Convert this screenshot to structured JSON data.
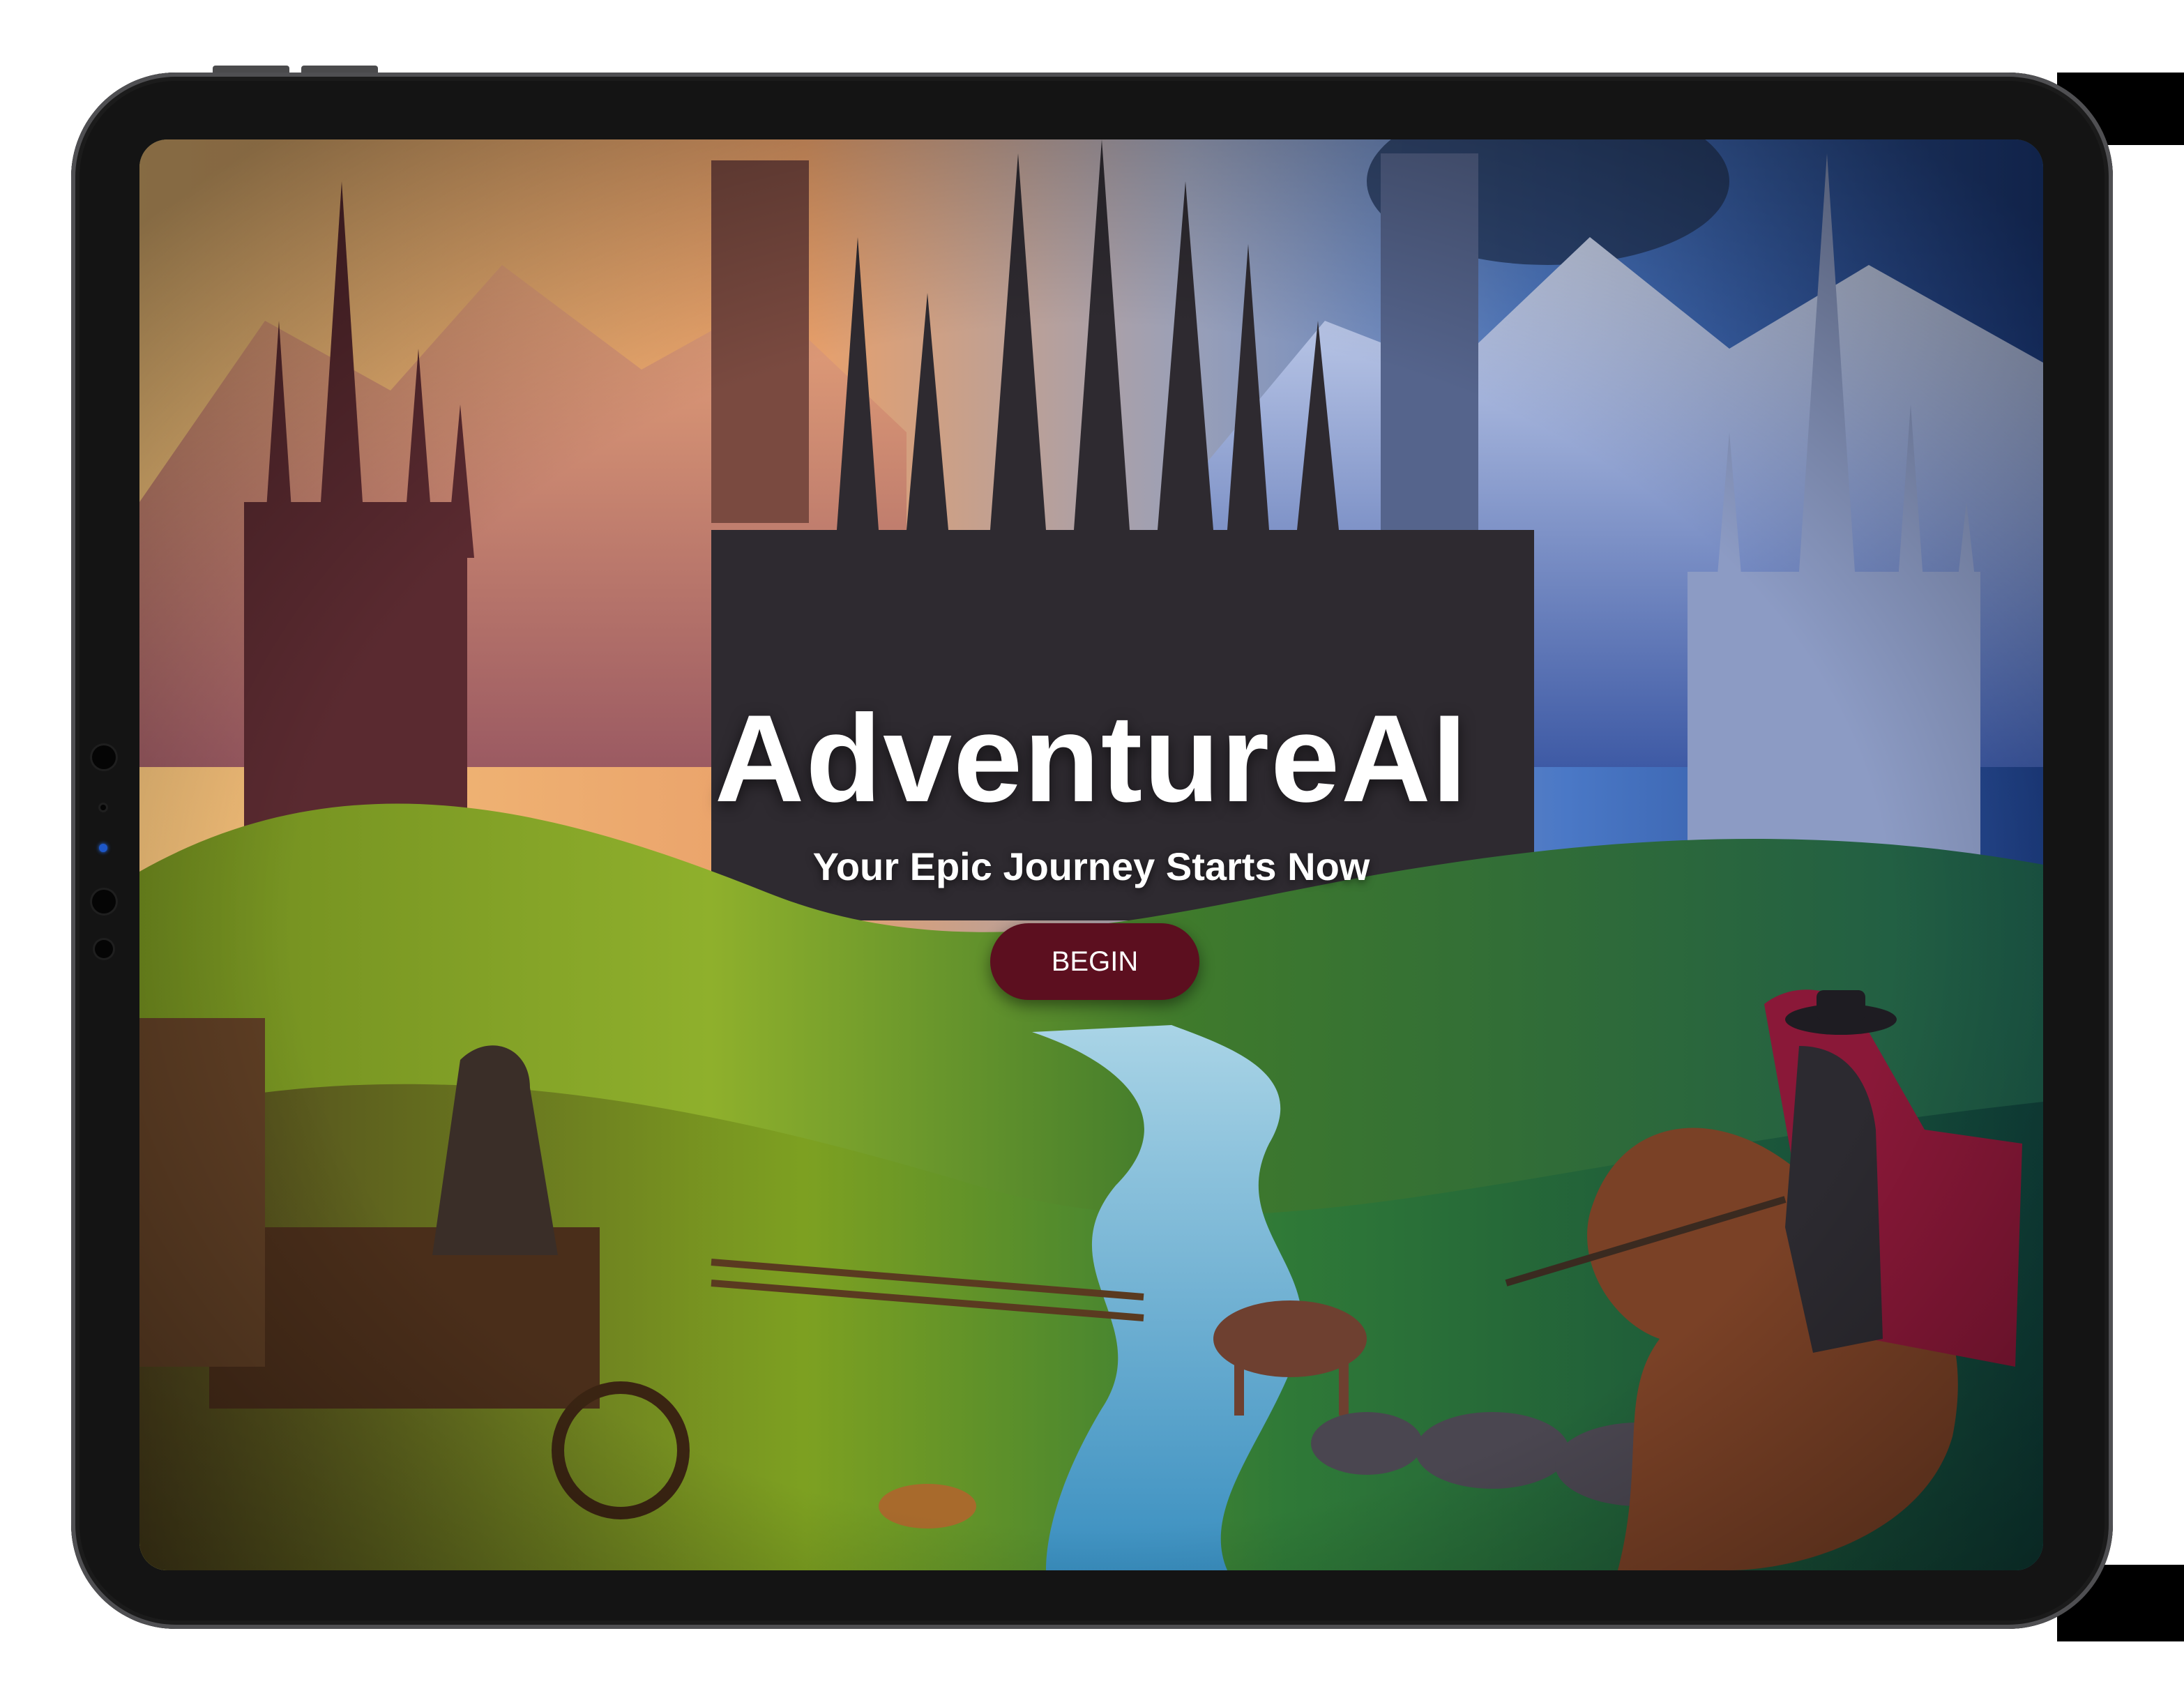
{
  "app": {
    "title": "AdventureAI",
    "subtitle": "Your Epic Journey Starts Now",
    "cta_label": "BEGIN"
  },
  "colors": {
    "button_bg": "#5c0f1f",
    "text": "#ffffff",
    "device_frame": "#141414"
  },
  "illustration": {
    "icon": "fantasy-landscape-illustration"
  }
}
